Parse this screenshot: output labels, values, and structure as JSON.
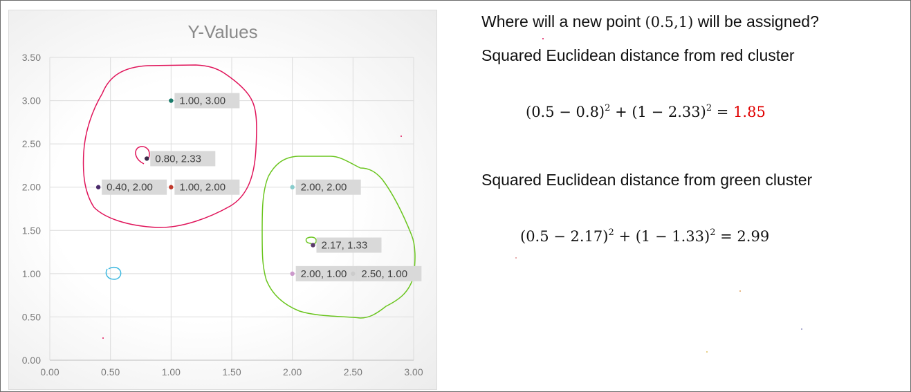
{
  "chart_data": {
    "type": "scatter",
    "title": "Y-Values",
    "xlim": [
      0,
      3
    ],
    "ylim": [
      0,
      3.5
    ],
    "x_ticks": [
      "0.00",
      "0.50",
      "1.00",
      "1.50",
      "2.00",
      "2.50",
      "3.00"
    ],
    "y_ticks": [
      "0.00",
      "0.50",
      "1.00",
      "1.50",
      "2.00",
      "2.50",
      "3.00",
      "3.50"
    ],
    "grid": true,
    "points": [
      {
        "x": 1.0,
        "y": 3.0,
        "label": "1.00, 3.00",
        "color": "#1a7a6a"
      },
      {
        "x": 0.8,
        "y": 2.33,
        "label": "0.80, 2.33",
        "color": "#3a2a4a"
      },
      {
        "x": 0.4,
        "y": 2.0,
        "label": "0.40, 2.00",
        "color": "#4a2a6a"
      },
      {
        "x": 1.0,
        "y": 2.0,
        "label": "1.00, 2.00",
        "color": "#c0392b"
      },
      {
        "x": 2.0,
        "y": 2.0,
        "label": "2.00, 2.00",
        "color": "#88cccc"
      },
      {
        "x": 2.17,
        "y": 1.33,
        "label": "2.17, 1.33",
        "color": "#5a3a6a"
      },
      {
        "x": 2.0,
        "y": 1.0,
        "label": "2.00, 1.00",
        "color": "#cc99cc"
      },
      {
        "x": 2.5,
        "y": 1.0,
        "label": "2.50, 1.00",
        "color": "#cccccc"
      }
    ],
    "annotations": {
      "red_cluster_color": "#e0145a",
      "green_cluster_color": "#6ac51e",
      "new_point_circle_color": "#3cb8e0",
      "new_point": {
        "x": 0.5,
        "y": 1.0
      }
    }
  },
  "text": {
    "question_a": "Where will a new point ",
    "question_point": "(0.5,1)",
    "question_b": " will be assigned?",
    "red_heading": "Squared Euclidean distance from red cluster",
    "red_eq_a": "(0.5 − 0.8)",
    "red_eq_exp1": "2",
    "red_eq_b": "  +  (1 − 2.33)",
    "red_eq_exp2": "2",
    "red_eq_c": "  =  ",
    "red_result": "1.85",
    "green_heading": "Squared Euclidean distance from green cluster",
    "green_eq_a": "(0.5 − 2.17)",
    "green_eq_exp1": "2",
    "green_eq_b": "  +  (1 − 1.33)",
    "green_eq_exp2": "2",
    "green_eq_c": "  =  ",
    "green_result": "2.99"
  },
  "colors": {
    "result_red": "#e00000",
    "text": "#111111"
  }
}
